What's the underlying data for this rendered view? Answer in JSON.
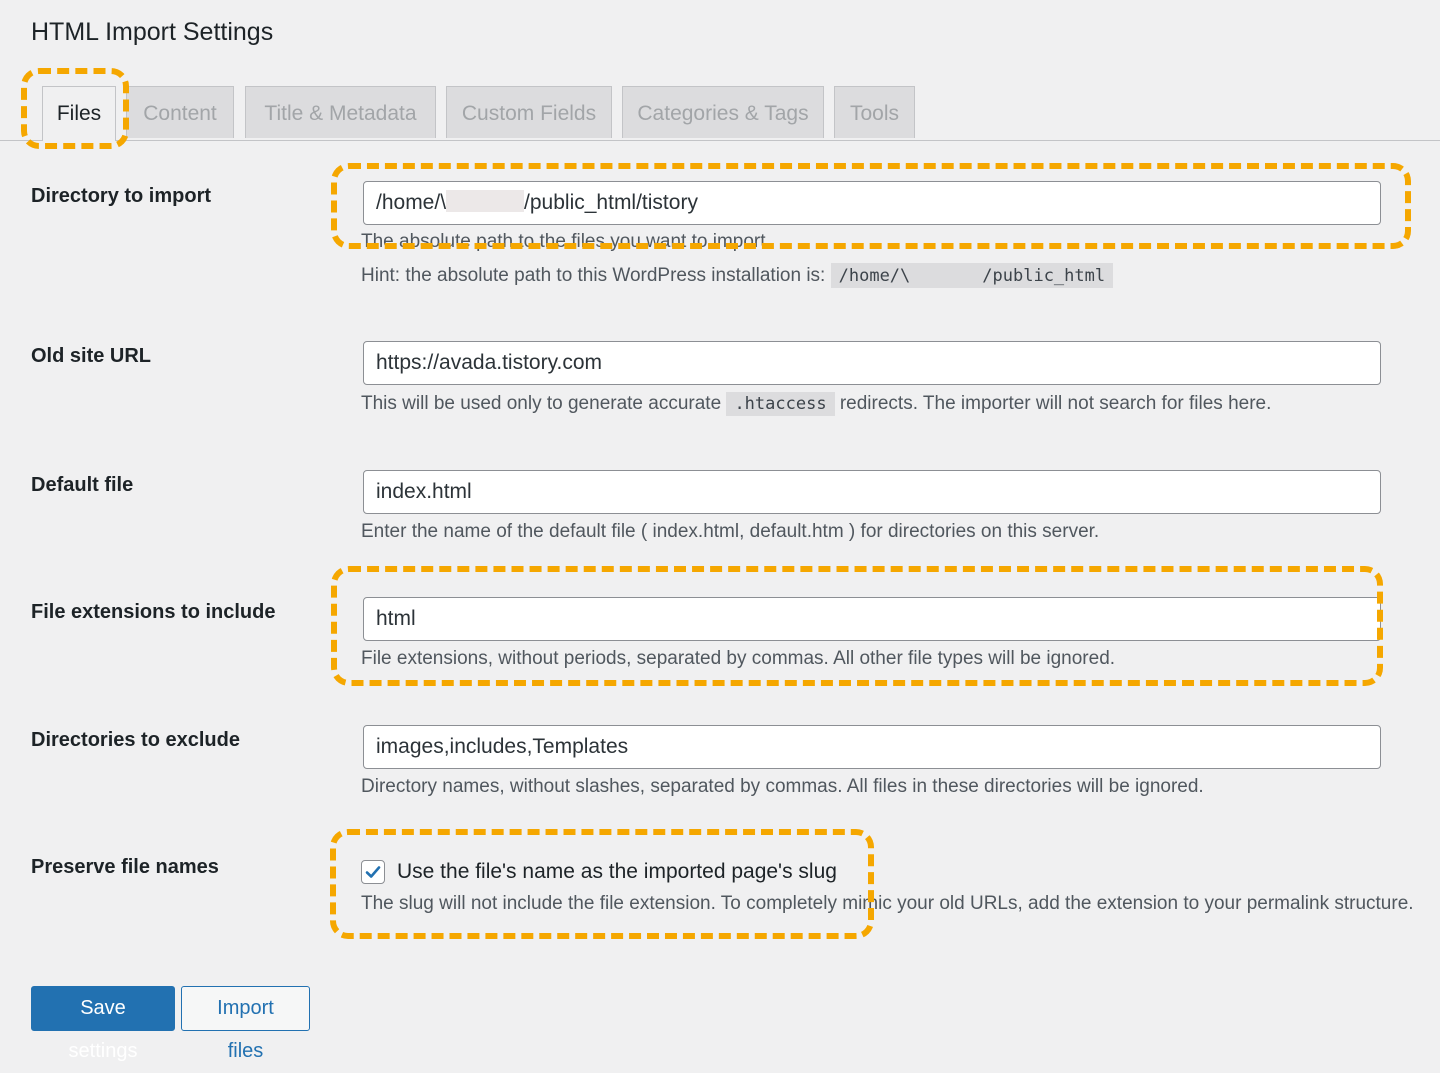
{
  "page_title": "HTML Import Settings",
  "tabs": [
    {
      "label": "Files",
      "active": true
    },
    {
      "label": "Content",
      "active": false
    },
    {
      "label": "Title & Metadata",
      "active": false
    },
    {
      "label": "Custom Fields",
      "active": false
    },
    {
      "label": "Categories & Tags",
      "active": false
    },
    {
      "label": "Tools",
      "active": false
    }
  ],
  "fields": {
    "directory": {
      "label": "Directory to import",
      "value_prefix": "/home/\\",
      "value_suffix": "/public_html/tistory",
      "desc": "The absolute path to the files you want to import.",
      "hint": "Hint: the absolute path to this WordPress installation is:",
      "hint_code_prefix": "/home/\\",
      "hint_code_suffix": "/public_html"
    },
    "old_url": {
      "label": "Old site URL",
      "value": "https://avada.tistory.com",
      "desc_before": "This will be used only to generate accurate",
      "desc_code": ".htaccess",
      "desc_after": "redirects. The importer will not search for files here."
    },
    "default_file": {
      "label": "Default file",
      "value": "index.html",
      "desc": "Enter the name of the default file ( index.html, default.htm ) for directories on this server."
    },
    "extensions": {
      "label": "File extensions to include",
      "value": "html",
      "desc": "File extensions, without periods, separated by commas. All other file types will be ignored."
    },
    "exclude": {
      "label": "Directories to exclude",
      "value": "images,includes,Templates",
      "desc": "Directory names, without slashes, separated by commas. All files in these directories will be ignored."
    },
    "preserve": {
      "label": "Preserve file names",
      "checkbox_label": "Use the file's name as the imported page's slug",
      "checked": true,
      "desc": "The slug will not include the file extension. To completely mimic your old URLs, add the extension to your permalink structure."
    }
  },
  "buttons": {
    "save": "Save settings",
    "import": "Import files"
  },
  "colors": {
    "highlight": "#f5a700",
    "primary": "#2271b1"
  }
}
